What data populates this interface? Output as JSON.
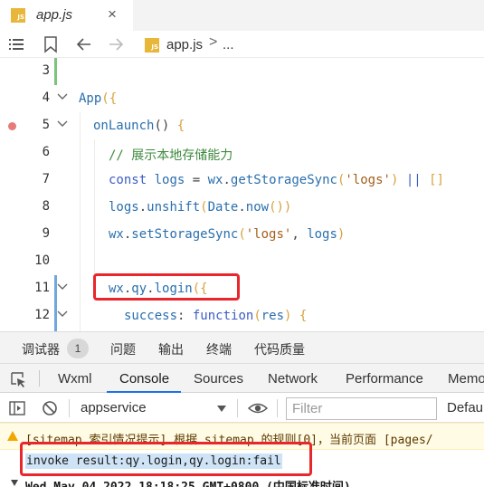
{
  "tab": {
    "badge": "JS",
    "title": "app.js",
    "close": "×"
  },
  "breadcrumb": {
    "badge": "JS",
    "file": "app.js",
    "separator": ">",
    "more": "..."
  },
  "editor": {
    "lines": [
      {
        "num": "3"
      },
      {
        "num": "4"
      },
      {
        "num": "5"
      },
      {
        "num": "6"
      },
      {
        "num": "7"
      },
      {
        "num": "8"
      },
      {
        "num": "9"
      },
      {
        "num": "10"
      },
      {
        "num": "11"
      },
      {
        "num": "12"
      }
    ]
  },
  "devtools": {
    "tabs": {
      "debugger": "调试器",
      "debugger_count": "1",
      "issues": "问题",
      "output": "输出",
      "terminal": "终端",
      "code_quality": "代码质量"
    },
    "panels": {
      "wxml": "Wxml",
      "console": "Console",
      "sources": "Sources",
      "network": "Network",
      "performance": "Performance",
      "memory": "Memo"
    },
    "toolbar": {
      "context": "appservice",
      "filter_placeholder": "Filter",
      "levels": "Defaul"
    },
    "messages": {
      "warning": "[sitemap 索引情况提示] 根据 sitemap 的规则[0]，当前页面 [pages/",
      "log": "invoke result:qy.login,qy.login:fail",
      "date": "Wed May 04 2022 18:18:25 GMT+0800 (中国标准时间)"
    }
  },
  "colors": {
    "highlight_box": "#e8262b",
    "active_tab": "#1a73e8",
    "warning_bg": "#fffbe5"
  }
}
